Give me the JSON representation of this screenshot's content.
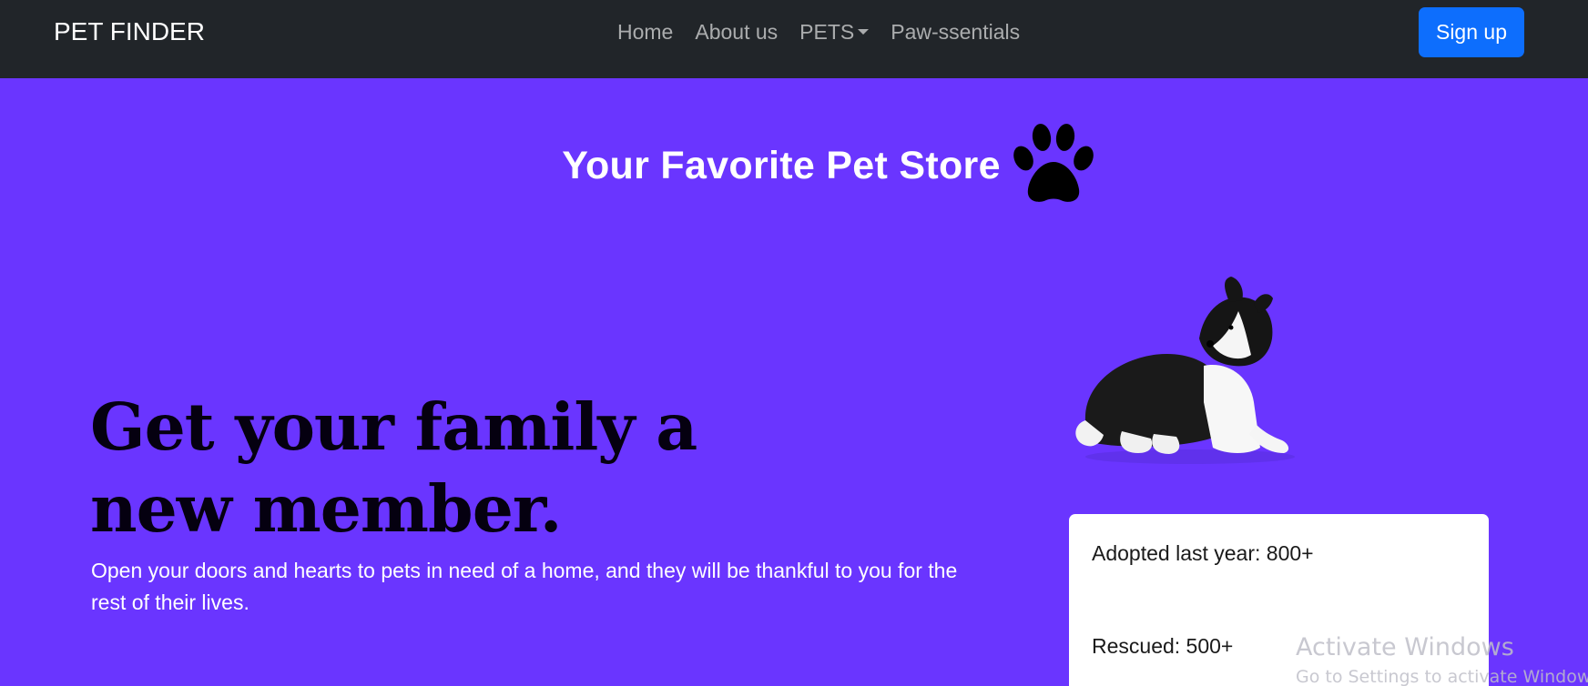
{
  "navbar": {
    "brand": "PET FINDER",
    "links": [
      {
        "label": "Home"
      },
      {
        "label": "About us"
      },
      {
        "label": "PETS",
        "dropdown": true
      },
      {
        "label": "Paw-ssentials"
      }
    ],
    "signup_label": "Sign up",
    "background": "#212529",
    "signup_color": "#0d6efd"
  },
  "hero": {
    "title": "Your Favorite Pet Store",
    "title_icon": "paw-icon",
    "headline": "Get your family a new member.",
    "lead": "Open your doors and hearts to pets in need of a home, and they will be thankful to you for the rest of their lives.",
    "background": "#6a35ff"
  },
  "stats": {
    "adopted": "Adopted last year: 800+",
    "rescued": "Rescued: 500+"
  },
  "watermark": {
    "line1": "Activate Windows",
    "line2": "Go to Settings to activate Windows."
  }
}
